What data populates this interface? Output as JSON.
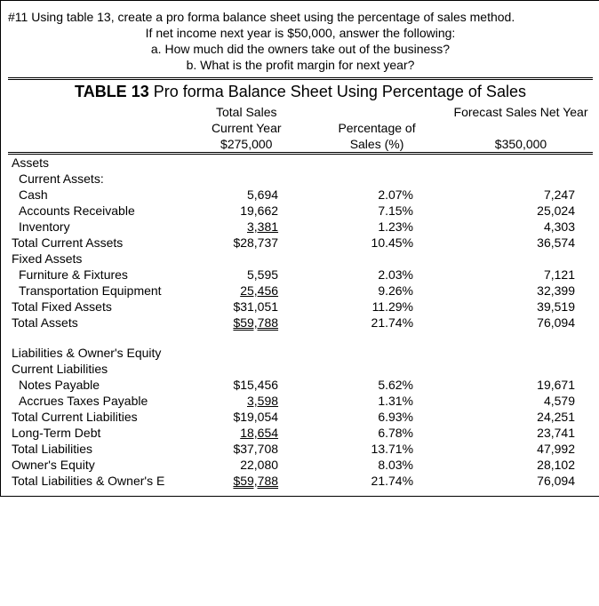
{
  "question": {
    "intro": "#11 Using table 13, create a pro forma balance sheet using the percentage of sales method.",
    "cond": "If net income next year is $50,000, answer the following:",
    "a": "a.   How much did the owners take out of the business?",
    "b": "b.  What is the profit margin for next year?"
  },
  "table": {
    "title_bold": "TABLE 13",
    "title_rest": " Pro forma Balance Sheet Using Percentage of Sales",
    "header": {
      "col1_l1": "Total Sales",
      "col1_l2": "Current Year",
      "col1_l3": "$275,000",
      "col2_l1": "Percentage of",
      "col2_l2": "Sales (%)",
      "col3_l1": "Forecast Sales Net Year",
      "col3_l2": "$350,000"
    },
    "sections": {
      "assets": "Assets",
      "current_assets": "Current Assets:",
      "fixed_assets": "Fixed Assets",
      "liab_eq": "Liabilities & Owner's Equity",
      "cur_liab": "Current  Liabilities"
    },
    "rows": {
      "cash": {
        "label": "Cash",
        "cy": "5,694",
        "pct": "2.07%",
        "fc": "7,247"
      },
      "ar": {
        "label": "Accounts Receivable",
        "cy": "19,662",
        "pct": "7.15%",
        "fc": "25,024"
      },
      "inv": {
        "label": "Inventory",
        "cy": "3,381",
        "pct": "1.23%",
        "fc": "4,303"
      },
      "tca": {
        "label": "Total Current Assets",
        "cy": "$28,737",
        "pct": "10.45%",
        "fc": "36,574"
      },
      "ff": {
        "label": "Furniture & Fixtures",
        "cy": "5,595",
        "pct": "2.03%",
        "fc": "7,121"
      },
      "te": {
        "label": "Transportation Equipment",
        "cy": "25,456",
        "pct": "9.26%",
        "fc": "32,399"
      },
      "tfa": {
        "label": "Total Fixed Assets",
        "cy": "$31,051",
        "pct": "11.29%",
        "fc": "39,519"
      },
      "ta": {
        "label": "Total Assets",
        "cy": "$59,788",
        "pct": "21.74%",
        "fc": "76,094"
      },
      "np": {
        "label": "Notes Payable",
        "cy": "$15,456",
        "pct": "5.62%",
        "fc": "19,671"
      },
      "atp": {
        "label": "Accrues Taxes Payable",
        "cy": "3,598",
        "pct": "1.31%",
        "fc": "4,579"
      },
      "tcl": {
        "label": "Total Current Liabilities",
        "cy": "$19,054",
        "pct": "6.93%",
        "fc": "24,251"
      },
      "ltd": {
        "label": "Long-Term Debt",
        "cy": "18,654",
        "pct": "6.78%",
        "fc": "23,741"
      },
      "tl": {
        "label": "Total Liabilities",
        "cy": "$37,708",
        "pct": "13.71%",
        "fc": "47,992"
      },
      "oe": {
        "label": "Owner's Equity",
        "cy": "22,080",
        "pct": "8.03%",
        "fc": "28,102"
      },
      "tloe": {
        "label": "Total Liabilities & Owner's E",
        "cy": "$59,788",
        "pct": "21.74%",
        "fc": "76,094"
      }
    }
  }
}
